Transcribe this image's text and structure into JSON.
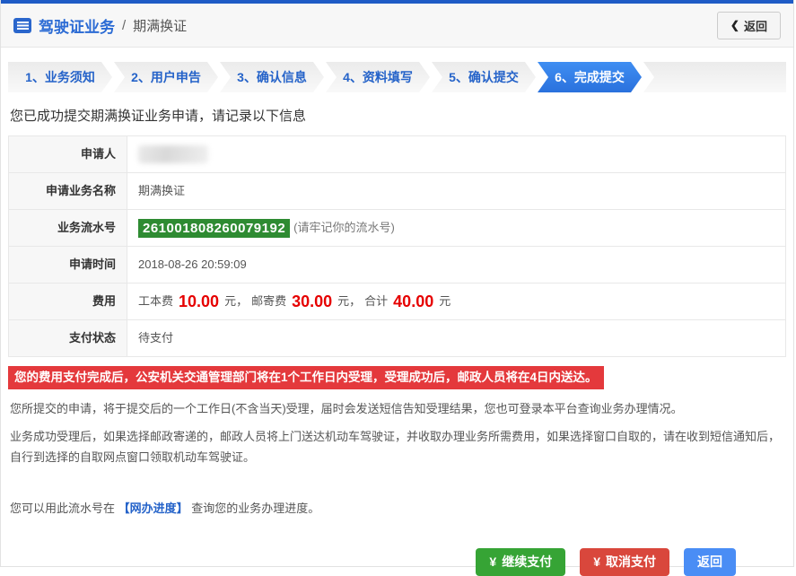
{
  "colors": {
    "topbar_blue": "#1e5bc6",
    "accent_blue": "#2b6bd4",
    "active_step_blue": "#2f7de0",
    "serial_green": "#2e8b32",
    "amount_red": "#e60000",
    "alert_red": "#e4393c",
    "btn_green": "#36a435",
    "btn_red": "#d9473c",
    "btn_blue": "#4a8df5"
  },
  "header": {
    "doc_icon": "document-list",
    "title": "驾驶证业务",
    "separator": "/",
    "subtitle": "期满换证",
    "back_icon": "❮",
    "back_label": "返回"
  },
  "steps": {
    "items": [
      {
        "label": "1、业务须知",
        "active": false
      },
      {
        "label": "2、用户申告",
        "active": false
      },
      {
        "label": "3、确认信息",
        "active": false
      },
      {
        "label": "4、资料填写",
        "active": false
      },
      {
        "label": "5、确认提交",
        "active": false
      },
      {
        "label": "6、完成提交",
        "active": true
      }
    ]
  },
  "main": {
    "success_message": "您已成功提交期满换证业务申请，请记录以下信息",
    "info_table": {
      "rows": [
        {
          "label": "申请人",
          "value": ""
        },
        {
          "label": "申请业务名称",
          "value": "期满换证"
        },
        {
          "label": "业务流水号",
          "serial": "261001808260079192",
          "note": "(请牢记你的流水号)"
        },
        {
          "label": "申请时间",
          "value": "2018-08-26 20:59:09"
        },
        {
          "label": "费用"
        },
        {
          "label": "支付状态",
          "value": "待支付"
        }
      ]
    },
    "fee": {
      "item1_label": "工本费",
      "item1_amount": "10.00",
      "item1_unit": "元，",
      "item2_label": "邮寄费",
      "item2_amount": "30.00",
      "item2_unit": "元，",
      "total_label": "合计",
      "total_amount": "40.00",
      "total_unit": "元"
    },
    "alert": "您的费用支付完成后，公安机关交通管理部门将在1个工作日内受理，受理成功后，邮政人员将在4日内送达。",
    "paragraphs": [
      "您所提交的申请，将于提交后的一个工作日(不含当天)受理，届时会发送短信告知受理结果，您也可登录本平台查询业务办理情况。",
      "业务成功受理后，如果选择邮政寄递的，邮政人员将上门送达机动车驾驶证，并收取办理业务所需费用，如果选择窗口自取的，请在收到短信通知后，自行到选择的自取网点窗口领取机动车驾驶证。"
    ],
    "progress_note": {
      "before": "您可以用此流水号在",
      "link": "【网办进度】",
      "after": "查询您的业务办理进度。"
    }
  },
  "footer": {
    "buttons": [
      {
        "icon": "¥",
        "label": "继续支付"
      },
      {
        "icon": "¥",
        "label": "取消支付"
      },
      {
        "icon": "",
        "label": "返回"
      }
    ]
  }
}
